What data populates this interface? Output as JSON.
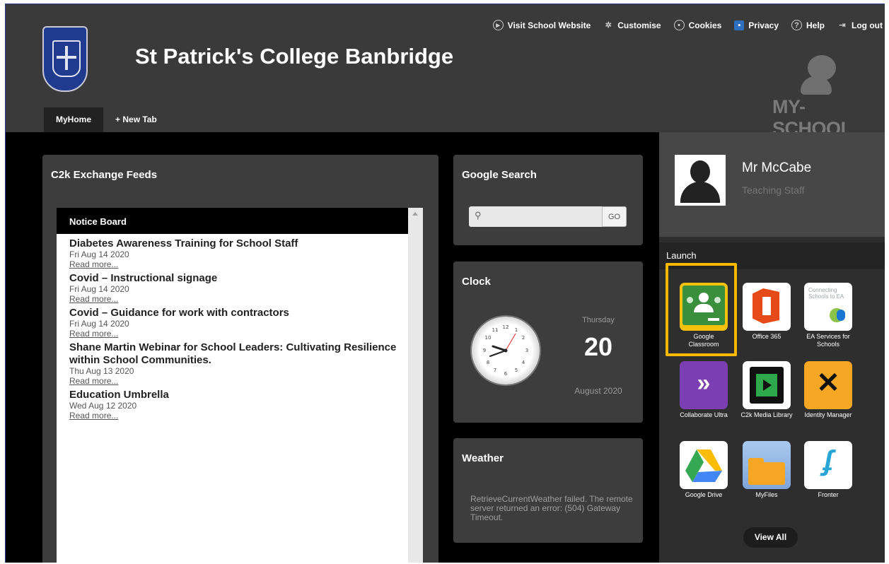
{
  "header": {
    "school_name": "St Patrick's College Banbridge",
    "logo_text": "MY-SCHOOL",
    "nav": [
      {
        "label": "Visit School Website",
        "icon": "play-circle-icon"
      },
      {
        "label": "Customise",
        "icon": "gear-icon"
      },
      {
        "label": "Cookies",
        "icon": "cookie-icon"
      },
      {
        "label": "Privacy",
        "icon": "privacy-icon"
      },
      {
        "label": "Help",
        "icon": "help-icon"
      },
      {
        "label": "Log out",
        "icon": "logout-icon"
      }
    ],
    "tabs": [
      {
        "label": "MyHome",
        "active": true
      },
      {
        "label": "+ New Tab",
        "active": false
      }
    ]
  },
  "feeds": {
    "title": "C2k Exchange Feeds",
    "board_title": "Notice Board",
    "items": [
      {
        "title": "Diabetes Awareness Training for School Staff",
        "date": "Fri Aug 14 2020",
        "link": "Read more..."
      },
      {
        "title": "Covid – Instructional signage",
        "date": "Fri Aug 14 2020",
        "link": "Read more..."
      },
      {
        "title": "Covid – Guidance for work with contractors",
        "date": "Fri Aug 14 2020",
        "link": "Read more..."
      },
      {
        "title": "Shane Martin Webinar for School Leaders: Cultivating Resilience within School Communities.",
        "date": "Thu Aug 13 2020",
        "link": "Read more..."
      },
      {
        "title": "Education Umbrella",
        "date": "Wed Aug 12 2020",
        "link": "Read more..."
      }
    ]
  },
  "search": {
    "title": "Google Search",
    "placeholder": "",
    "button": "GO"
  },
  "clock": {
    "title": "Clock",
    "day_name": "Thursday",
    "day_number": "20",
    "month_year": "August 2020"
  },
  "weather": {
    "title": "Weather",
    "message": "RetrieveCurrentWeather failed. The remote server returned an error: (504) Gateway Timeout."
  },
  "profile": {
    "name": "Mr McCabe",
    "role": "Teaching Staff"
  },
  "launch": {
    "title": "Launch",
    "apps": [
      {
        "label": "Google Classroom",
        "icon": "google-classroom-icon",
        "color": "#3a8f3c"
      },
      {
        "label": "Office 365",
        "icon": "office-365-icon",
        "color": "#e64a19"
      },
      {
        "label": "EA Services for Schools",
        "icon": "ea-services-icon",
        "color": "#ffffff",
        "tile_text": "Connecting Schools to EA"
      },
      {
        "label": "Collaborate Ultra",
        "icon": "collaborate-ultra-icon",
        "color": "#7b3fb3"
      },
      {
        "label": "C2k Media Library",
        "icon": "media-library-icon",
        "color": "#ffffff"
      },
      {
        "label": "Identity Manager",
        "icon": "identity-manager-icon",
        "color": "#f5a623"
      },
      {
        "label": "Google Drive",
        "icon": "google-drive-icon",
        "color": "#ffffff"
      },
      {
        "label": "MyFiles",
        "icon": "myfiles-icon",
        "color": "#8fb4e0"
      },
      {
        "label": "Fronter",
        "icon": "fronter-icon",
        "color": "#ffffff"
      }
    ],
    "view_all": "View All"
  }
}
